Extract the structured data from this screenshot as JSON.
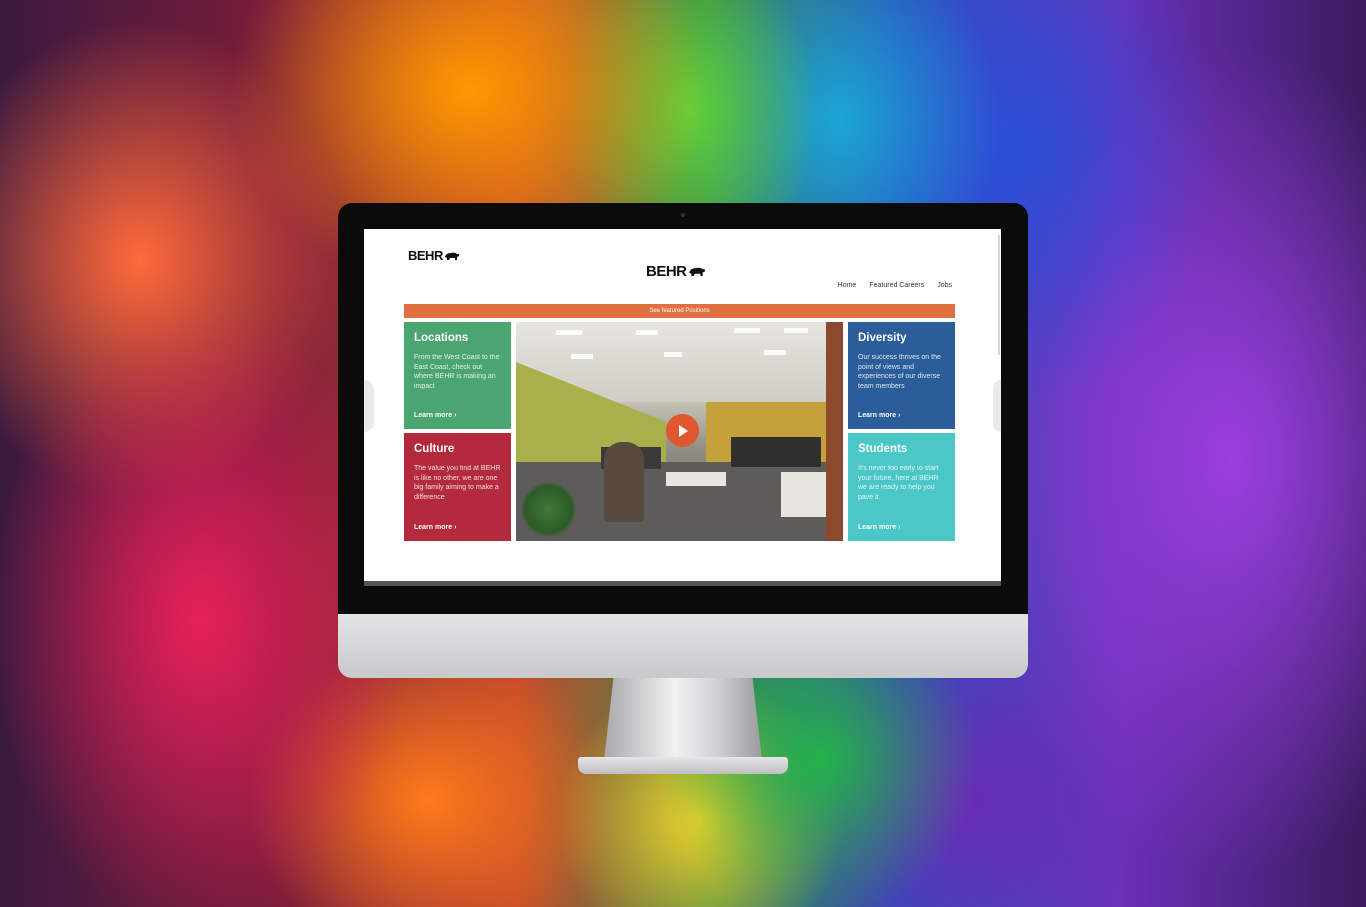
{
  "brand": {
    "logo_text": "BEHR"
  },
  "nav": {
    "items": [
      "Home",
      "Featured Careers",
      "Jobs"
    ]
  },
  "banner": {
    "text": "See featured Positions"
  },
  "tiles": {
    "locations": {
      "title": "Locations",
      "body": "From the West Coast to the East Coast, check out where BEHR is making an impact",
      "link": "Learn more"
    },
    "culture": {
      "title": "Culture",
      "body": "The value you find at BEHR is like no other, we are one big family aiming to make a difference",
      "link": "Learn more"
    },
    "diversity": {
      "title": "Diversity",
      "body": "Our success thrives on the point of views and experiences of our diverse team members",
      "link": "Learn more"
    },
    "students": {
      "title": "Students",
      "body": "It's never too early to start your future, here at BEHR we are ready to help you pave it",
      "link": "Learn more"
    }
  },
  "colors": {
    "accent": "#e0703f",
    "green": "#4aa570",
    "red": "#b32a3c",
    "blue": "#2a5d9a",
    "teal": "#4bc7c8"
  }
}
